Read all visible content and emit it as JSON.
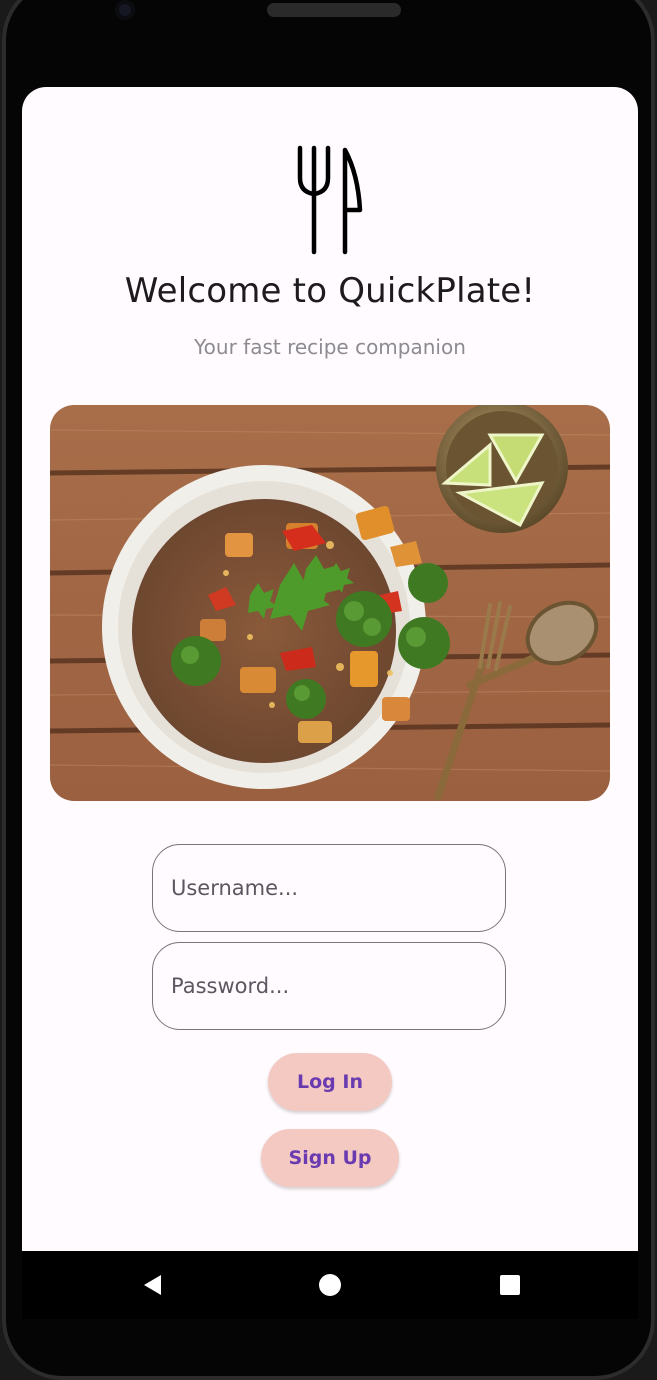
{
  "app": {
    "title": "Welcome to QuickPlate!",
    "subtitle": "Your fast recipe companion",
    "logo_icon": "fork-knife-icon"
  },
  "login_form": {
    "username_placeholder": "Username...",
    "password_placeholder": "Password...",
    "login_label": "Log In",
    "signup_label": "Sign Up"
  },
  "hero_image": {
    "description_icon": "food-bowl-image"
  },
  "navigation": {
    "back_icon": "back-triangle-icon",
    "home_icon": "home-circle-icon",
    "recents_icon": "recents-square-icon"
  },
  "colors": {
    "background": "#fffbfe",
    "button_bg": "#f3c9c2",
    "button_text": "#6a3bb0",
    "field_border": "#79747e"
  }
}
